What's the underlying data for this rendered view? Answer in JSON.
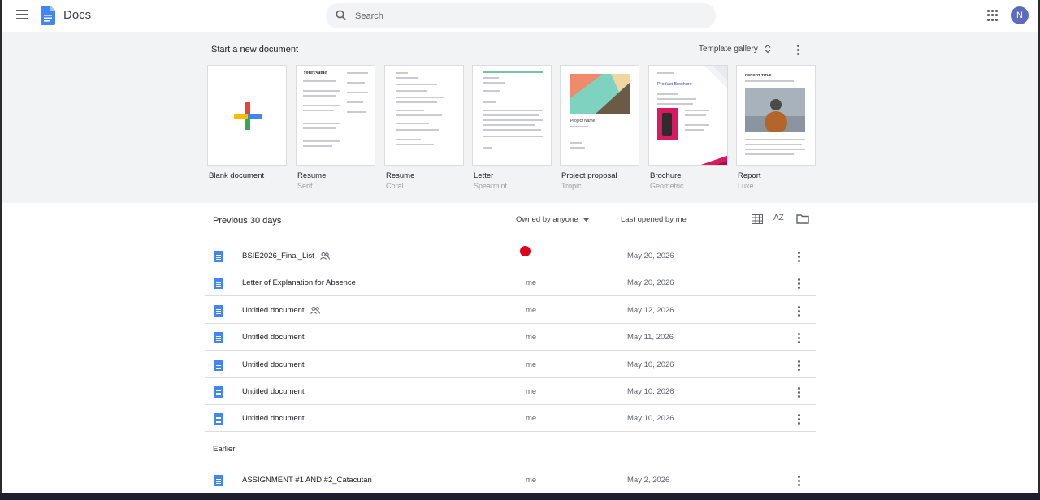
{
  "app": {
    "title": "Docs",
    "avatar_letter": "N"
  },
  "search": {
    "placeholder": "Search"
  },
  "templates": {
    "heading": "Start a new document",
    "gallery_label": "Template gallery",
    "items": [
      {
        "name": "Blank document",
        "sub": ""
      },
      {
        "name": "Resume",
        "sub": "Serif"
      },
      {
        "name": "Resume",
        "sub": "Coral"
      },
      {
        "name": "Letter",
        "sub": "Spearmint"
      },
      {
        "name": "Project proposal",
        "sub": "Tropic"
      },
      {
        "name": "Brochure",
        "sub": "Geometric"
      },
      {
        "name": "Report",
        "sub": "Luxe"
      }
    ],
    "thumb_text": {
      "resume_serif_name": "Your Name",
      "proposal_title": "Project Name",
      "brochure_title": "Product Brochure",
      "report_title": "REPORT TITLE"
    }
  },
  "recent": {
    "heading": "Previous 30 days",
    "owner_filter": "Owned by anyone",
    "sort_label": "Last opened by me",
    "sort_icon_text": "AZ",
    "earlier_heading": "Earlier",
    "documents": [
      {
        "name": "BSIE2026_Final_List",
        "shared": true,
        "owner": "",
        "date": "May 20, 2026"
      },
      {
        "name": "Letter of Explanation for Absence",
        "shared": false,
        "owner": "me",
        "date": "May 20, 2026"
      },
      {
        "name": "Untitled document",
        "shared": true,
        "owner": "me",
        "date": "May 12, 2026"
      },
      {
        "name": "Untitled document",
        "shared": false,
        "owner": "me",
        "date": "May 11, 2026"
      },
      {
        "name": "Untitled document",
        "shared": false,
        "owner": "me",
        "date": "May 10, 2026"
      },
      {
        "name": "Untitled document",
        "shared": false,
        "owner": "me",
        "date": "May 10, 2026"
      },
      {
        "name": "Untitled document",
        "shared": false,
        "owner": "me",
        "date": "May 10, 2026"
      }
    ],
    "earlier_documents": [
      {
        "name": "ASSIGNMENT #1 AND #2_Catacutan",
        "shared": false,
        "owner": "me",
        "date": "May 2, 2026"
      }
    ]
  },
  "colors": {
    "accent": "#4285f4",
    "brand_red": "#ea4335",
    "brand_yellow": "#fbbc04",
    "brand_green": "#34a853",
    "avatar": "#5c6bc0"
  },
  "icons": [
    "menu-icon",
    "docs-logo-icon",
    "search-icon",
    "apps-icon",
    "sort-arrows-icon",
    "more-vert-icon",
    "chevron-down-icon",
    "grid-view-icon",
    "sort-az-icon",
    "folder-icon",
    "doc-icon",
    "shared-people-icon"
  ]
}
